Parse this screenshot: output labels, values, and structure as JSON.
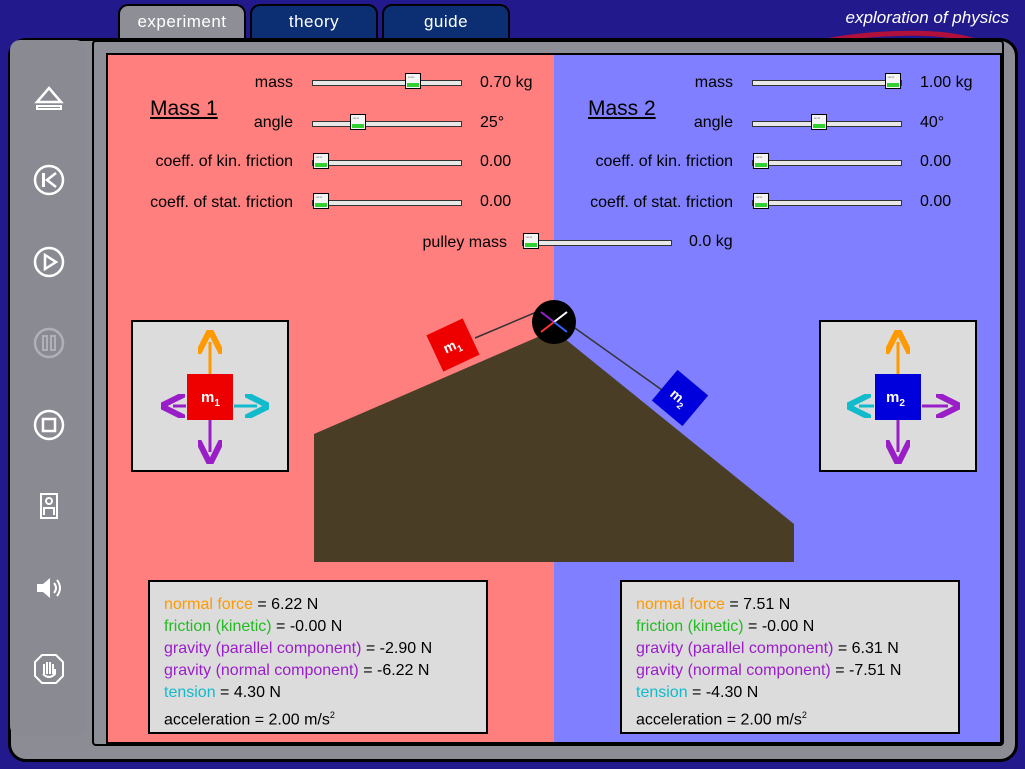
{
  "tabs": [
    {
      "label": "experiment",
      "active": true
    },
    {
      "label": "theory",
      "active": false
    },
    {
      "label": "guide",
      "active": false
    }
  ],
  "brand": "exploration of physics",
  "sidebar_icons": [
    "eject-icon",
    "rewind-icon",
    "play-icon",
    "pause-icon",
    "stop-icon",
    "person-icon",
    "speaker-icon",
    "hand-icon"
  ],
  "mass1": {
    "title": "Mass 1",
    "mass_label": "mass",
    "mass_value": "0.70 kg",
    "mass_fraction": 0.7,
    "angle_label": "angle",
    "angle_value": "25°",
    "angle_fraction": 0.28,
    "kin_label": "coeff. of kin. friction",
    "kin_value": "0.00",
    "kin_fraction": 0.0,
    "stat_label": "coeff. of stat. friction",
    "stat_value": "0.00",
    "stat_fraction": 0.0,
    "box_label": "m",
    "box_sub": "1",
    "info": {
      "normal_label": "normal force",
      "normal_value": " = 6.22 N",
      "friction_label": "friction (kinetic)",
      "friction_value": " = -0.00 N",
      "gpar_label": "gravity (parallel component)",
      "gpar_value": " = -2.90 N",
      "gnorm_label": "gravity (normal component)",
      "gnorm_value": " = -6.22 N",
      "tension_label": "tension",
      "tension_value": " = 4.30 N",
      "accel_label": "acceleration = 2.00 m/s",
      "accel_sup": "2"
    }
  },
  "mass2": {
    "title": "Mass 2",
    "mass_label": "mass",
    "mass_value": "1.00 kg",
    "mass_fraction": 1.0,
    "angle_label": "angle",
    "angle_value": "40°",
    "angle_fraction": 0.44,
    "kin_label": "coeff. of kin. friction",
    "kin_value": "0.00",
    "kin_fraction": 0.0,
    "stat_label": "coeff. of stat. friction",
    "stat_value": "0.00",
    "stat_fraction": 0.0,
    "box_label": "m",
    "box_sub": "2",
    "info": {
      "normal_label": "normal force",
      "normal_value": " = 7.51 N",
      "friction_label": "friction (kinetic)",
      "friction_value": " = -0.00 N",
      "gpar_label": "gravity (parallel component)",
      "gpar_value": " = 6.31 N",
      "gnorm_label": "gravity (normal component)",
      "gnorm_value": " = -7.51 N",
      "tension_label": "tension",
      "tension_value": " = -4.30 N",
      "accel_label": "acceleration = 2.00 m/s",
      "accel_sup": "2"
    }
  },
  "pulley": {
    "label": "pulley mass",
    "value": "0.0 kg",
    "fraction": 0.0
  },
  "colors": {
    "left_bg": "#ff7f7f",
    "right_bg": "#7f7fff",
    "ground": "#4a3d26",
    "mass1": "#ee0000",
    "mass2": "#0000dd",
    "normal": "#ff9900",
    "friction": "#22bb22",
    "gravity": "#9a1ec8",
    "tension": "#11bbcc"
  }
}
